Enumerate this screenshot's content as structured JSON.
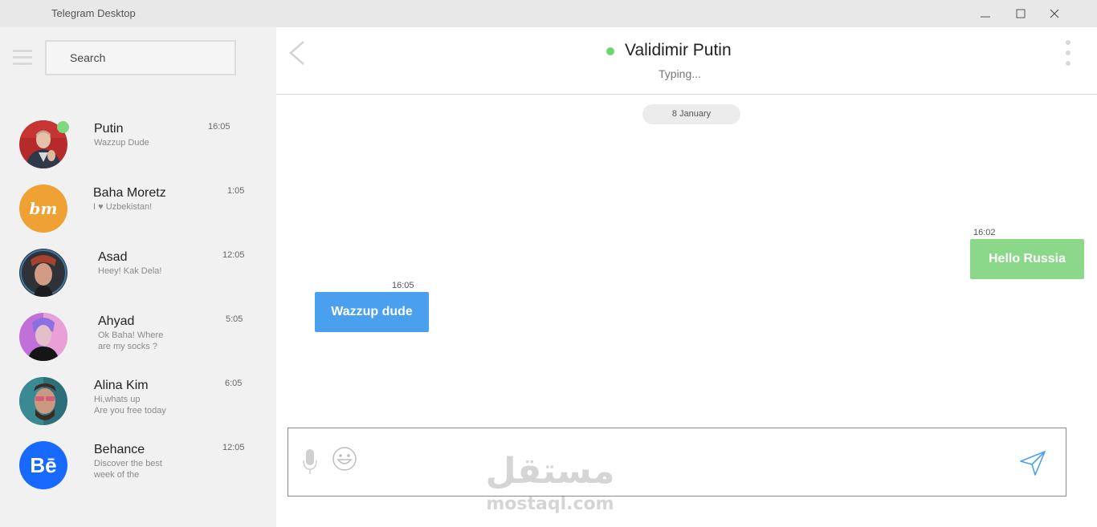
{
  "window": {
    "title": "Telegram Desktop",
    "controls": {
      "minimize": "minimize-icon",
      "maximize": "maximize-icon",
      "close": "close-icon"
    }
  },
  "sidebar": {
    "menu_icon": "hamburger-icon",
    "search": {
      "placeholder": "Search",
      "value": ""
    },
    "chats": [
      {
        "name": "Putin",
        "preview": [
          "Wazzup Dude"
        ],
        "time": "16:05",
        "online": true,
        "avatar": "portrait-photo"
      },
      {
        "name": "Baha Moretz",
        "preview": [
          "I ♥ Uzbekistan!"
        ],
        "time": "1:05",
        "online": false,
        "avatar": "bm-logo",
        "avatar_text": "bm",
        "avatar_color": "#f0a133"
      },
      {
        "name": "Asad",
        "preview": [
          "Heey! Kak Dela!"
        ],
        "time": "12:05",
        "online": false,
        "avatar": "portrait-photo"
      },
      {
        "name": "Ahyad",
        "preview": [
          "Ok Baha! Where",
          "are my socks ?"
        ],
        "time": "5:05",
        "online": false,
        "avatar": "portrait-photo"
      },
      {
        "name": "Alina Kim",
        "preview": [
          "Hi,whats up",
          "Are you free today"
        ],
        "time": "6:05",
        "online": false,
        "avatar": "portrait-photo"
      },
      {
        "name": "Behance",
        "preview": [
          "Discover the best",
          "week of the"
        ],
        "time": "12:05",
        "online": false,
        "avatar": "behance-logo",
        "avatar_text": "Bē",
        "avatar_color": "#1769ff"
      }
    ]
  },
  "conversation": {
    "contact_name": "Validimir Putin",
    "status": "Typing...",
    "online_color": "#6dd66d",
    "date_label": "8 January",
    "messages": [
      {
        "direction": "outgoing",
        "text": "Hello Russia",
        "time": "16:02",
        "color": "#8cd88a"
      },
      {
        "direction": "incoming",
        "text": "Wazzup dude",
        "time": "16:05",
        "color": "#4aa0ee"
      }
    ]
  },
  "composer": {
    "placeholder": "",
    "value": "",
    "icons": {
      "mic": "microphone-icon",
      "emoji": "emoji-icon",
      "send": "send-icon"
    }
  },
  "watermark": {
    "arabic": "مستقل",
    "latin": "mostaql.com"
  }
}
